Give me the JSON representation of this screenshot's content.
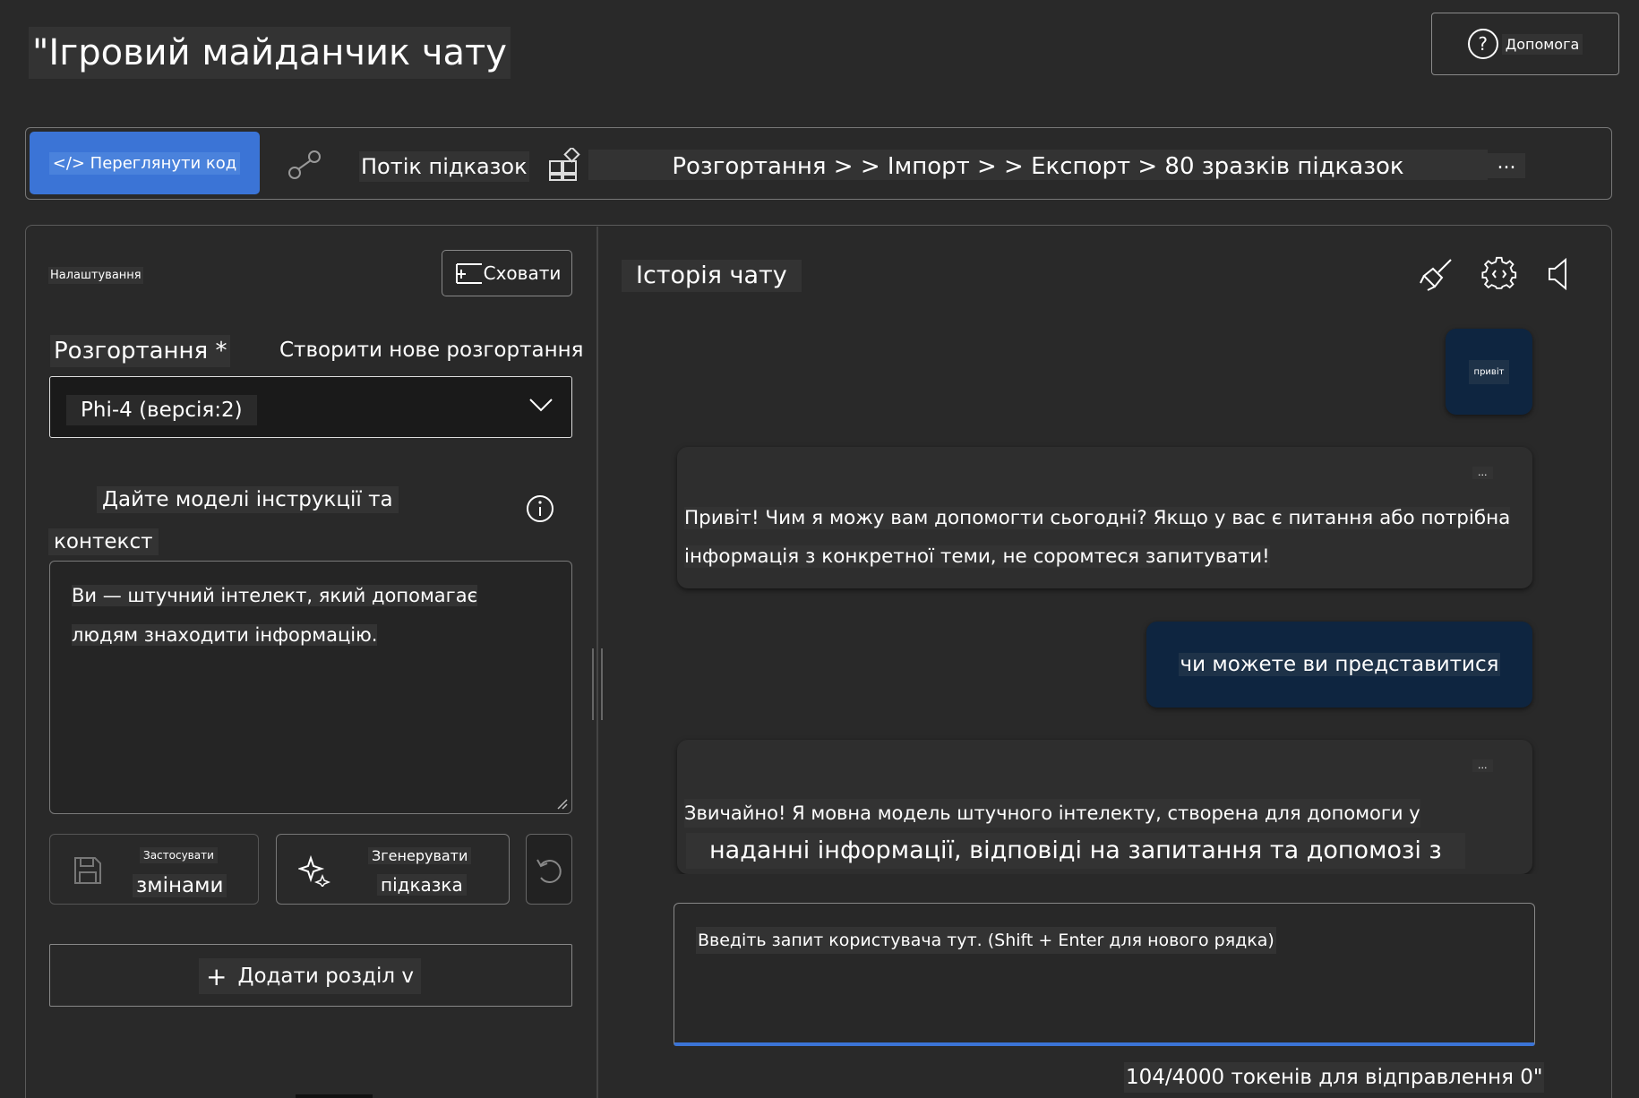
{
  "header": {
    "title": "\"Ігровий майданчик чату",
    "help_label": "Допомога"
  },
  "toolbar": {
    "view_code_label": "</> Переглянути код",
    "prompt_flow_label": "Потік підказок",
    "breadcrumb": "Розгортання > > Імпорт > > Експорт > 80 зразків підказок",
    "more_label": "..."
  },
  "settings": {
    "title": "Налаштування",
    "hide_label": "Сховати",
    "deploy_label": "Розгортання *",
    "create_deploy_label": "Створити нове розгортання",
    "deploy_value": "Phi-4 (версія:2)",
    "instructions_line1": "Дайте моделі інструкції та",
    "instructions_line2": "контекст",
    "system_message_line1": "Ви — штучний інтелект, який допомагає",
    "system_message_line2": "людям знаходити інформацію.",
    "apply_top": "Застосувати",
    "apply_bottom": "змінами",
    "generate_top": "Згенерувати",
    "generate_bottom": "підказка",
    "add_section_label": "Додати розділ v"
  },
  "chat": {
    "title": "Історія чату",
    "messages": [
      {
        "role": "user",
        "text": "привіт"
      },
      {
        "role": "assistant",
        "more": "...",
        "line1": "Привіт! Чим я можу вам допомогти сьогодні? Якщо у вас є питання або потрібна",
        "line2": "інформація з конкретної теми, не соромтеся запитувати!"
      },
      {
        "role": "user",
        "text": "чи можете ви представитися"
      },
      {
        "role": "assistant",
        "more": "...",
        "line1": "Звичайно! Я мовна модель штучного інтелекту, створена для допомоги у",
        "line2": "наданні інформації, відповіді на запитання та допомозі з"
      }
    ],
    "input_placeholder": "Введіть запит користувача тут. (Shift + Enter для нового рядка)",
    "token_count": "104/4000 токенів для відправлення 0\""
  },
  "colors": {
    "background": "#292929",
    "accent": "#3b74d6",
    "user_bubble": "#0e2540"
  },
  "icons": [
    "help-icon",
    "prompt-flow-icon",
    "apps-icon",
    "chevron-down-icon",
    "info-icon",
    "save-icon",
    "sparkle-icon",
    "undo-icon",
    "broom-icon",
    "settings-gear-icon",
    "speaker-icon",
    "plus-icon"
  ]
}
